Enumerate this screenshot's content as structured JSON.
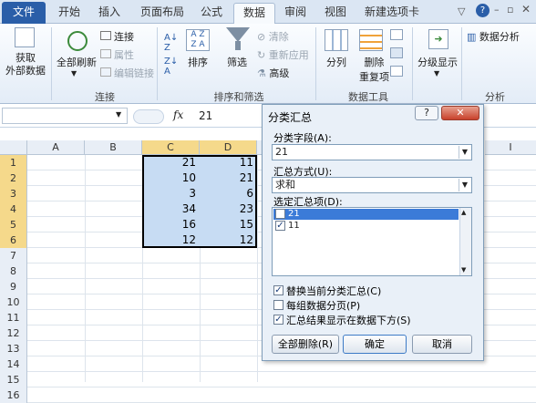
{
  "tabs": {
    "file": "文件",
    "items": [
      "开始",
      "插入",
      "页面布局",
      "公式",
      "数据",
      "审阅",
      "视图",
      "新建选项卡"
    ],
    "active_index": 4
  },
  "ribbon": {
    "get_external": "获取\n外部数据",
    "refresh_all": "全部刷新",
    "connections": "连接",
    "properties": "属性",
    "edit_links": "编辑链接",
    "sort": "排序",
    "filter": "筛选",
    "clear": "清除",
    "reapply": "重新应用",
    "advanced": "高级",
    "text_to_columns": "分列",
    "remove_duplicates": "删除",
    "remove_duplicates2": "重复项",
    "group_outline": "分级显示",
    "data_analysis": "数据分析",
    "groups": {
      "connections": "连接",
      "sort_filter": "排序和筛选",
      "data_tools": "数据工具",
      "analysis": "分析"
    }
  },
  "formula_bar": {
    "fx": "fx",
    "value": "21"
  },
  "sheet": {
    "columns": [
      "A",
      "B",
      "C",
      "D",
      "E",
      "I"
    ],
    "rows": [
      "1",
      "2",
      "3",
      "4",
      "5",
      "6",
      "7",
      "8",
      "9",
      "10",
      "11",
      "12",
      "13",
      "14",
      "15",
      "16"
    ],
    "col_c": [
      "21",
      "10",
      "3",
      "34",
      "16",
      "12"
    ],
    "col_d": [
      "11",
      "21",
      "6",
      "23",
      "15",
      "12"
    ]
  },
  "dialog": {
    "title": "分类汇总",
    "help": "?",
    "group_by_label": "分类字段(A):",
    "group_by_value": "21",
    "function_label": "汇总方式(U):",
    "function_value": "求和",
    "subtotal_label": "选定汇总项(D):",
    "subtotal_items": [
      {
        "label": "21",
        "checked": false
      },
      {
        "label": "11",
        "checked": true
      }
    ],
    "opt_replace": "替换当前分类汇总(C)",
    "opt_pagebreak": "每组数据分页(P)",
    "opt_summary_below": "汇总结果显示在数据下方(S)",
    "btn_remove_all": "全部删除(R)",
    "btn_ok": "确定",
    "btn_cancel": "取消"
  },
  "colors": {
    "accent": "#2a5ea8",
    "selection": "#c7dcf3",
    "header_highlight": "#f5d98b"
  }
}
